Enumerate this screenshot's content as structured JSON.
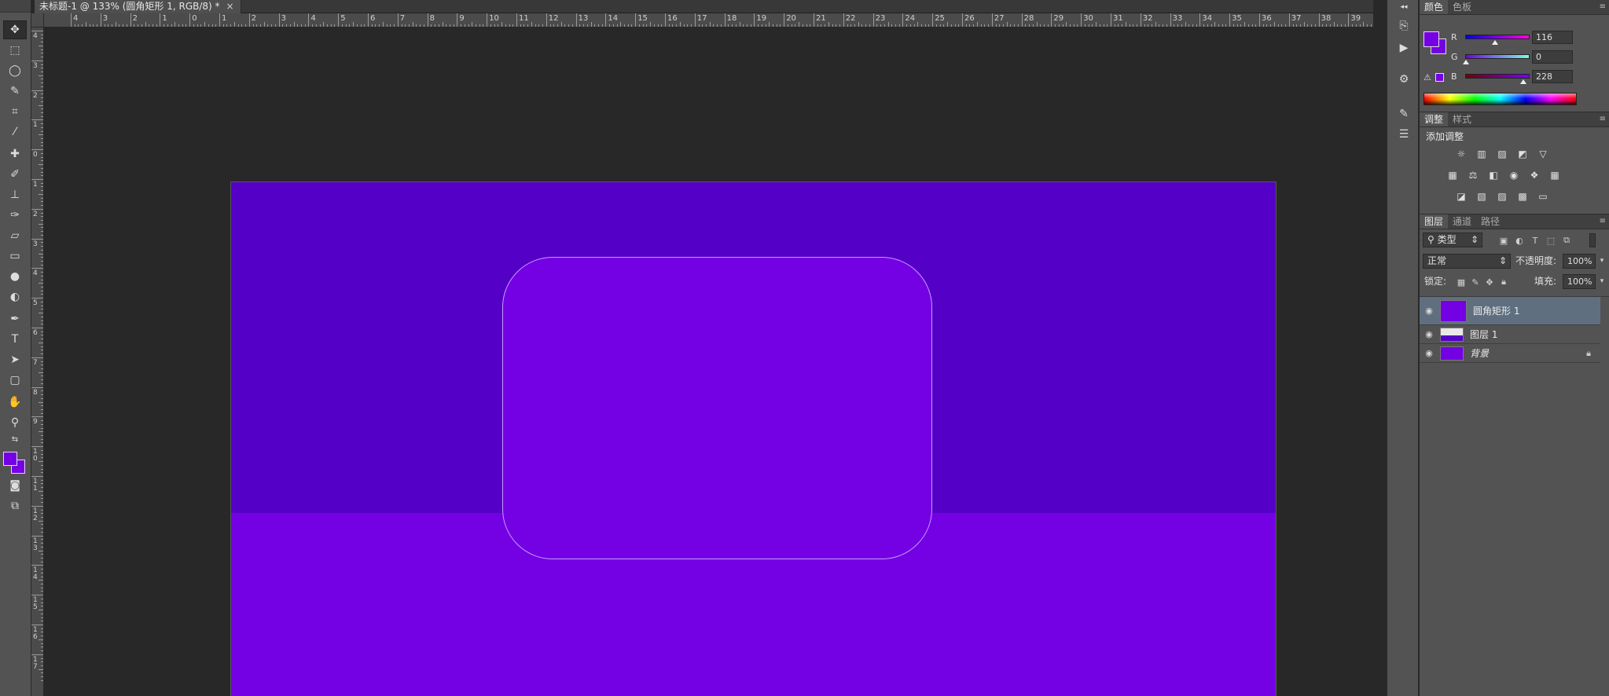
{
  "document": {
    "tab_title": "未标题-1 @ 133% (圆角矩形 1, RGB/8) *",
    "tab_close": "×"
  },
  "rulers": {
    "horizontal": [
      "4",
      "3",
      "2",
      "1",
      "0",
      "1",
      "2",
      "3",
      "4",
      "5",
      "6",
      "7",
      "8",
      "9",
      "10",
      "11",
      "12",
      "13",
      "14",
      "15",
      "16",
      "17",
      "18",
      "19",
      "20",
      "21",
      "22",
      "23",
      "24",
      "25",
      "26",
      "27",
      "28",
      "29",
      "30",
      "31",
      "32",
      "33",
      "34",
      "35",
      "36",
      "37",
      "38",
      "39"
    ],
    "vertical": [
      "4",
      "3",
      "2",
      "1",
      "0",
      "1",
      "2",
      "3",
      "4",
      "5",
      "6",
      "7",
      "8",
      "9",
      "10",
      "11",
      "12",
      "13",
      "14",
      "15",
      "16",
      "17"
    ]
  },
  "colors": {
    "foreground": "#7400e4",
    "background": "#7400e4",
    "doc_top": "#5500c6",
    "doc_bottom": "#7400e4",
    "rect_fill": "#7400e4"
  },
  "color_panel": {
    "tabs": [
      "颜色",
      "色板"
    ],
    "r_label": "R",
    "r_value": "116",
    "r_fraction": 0.455,
    "g_label": "G",
    "g_value": "0",
    "g_fraction": 0.0,
    "b_label": "B",
    "b_value": "228",
    "b_fraction": 0.894
  },
  "adjust_panel": {
    "tabs": [
      "调整",
      "样式"
    ],
    "heading": "添加调整"
  },
  "layers_panel": {
    "tabs": [
      "图层",
      "通道",
      "路径"
    ],
    "filter_label": "类型",
    "blend_mode": "正常",
    "opacity_label": "不透明度:",
    "opacity_value": "100%",
    "lock_label": "锁定:",
    "fill_label": "填充:",
    "fill_value": "100%",
    "layers": [
      {
        "name": "圆角矩形 1",
        "selected": true
      },
      {
        "name": "图层 1",
        "selected": false
      },
      {
        "name": "背景",
        "selected": false,
        "locked": true
      }
    ]
  },
  "icons": {
    "tools": [
      "move-icon",
      "marquee-icon",
      "lasso-icon",
      "quick-select-icon",
      "crop-icon",
      "eyedropper-icon",
      "healing-icon",
      "brush-icon",
      "stamp-icon",
      "history-brush-icon",
      "eraser-icon",
      "gradient-icon",
      "blur-icon",
      "dodge-icon",
      "pen-icon",
      "type-icon",
      "path-select-icon",
      "shape-icon",
      "hand-icon",
      "zoom-icon"
    ]
  }
}
